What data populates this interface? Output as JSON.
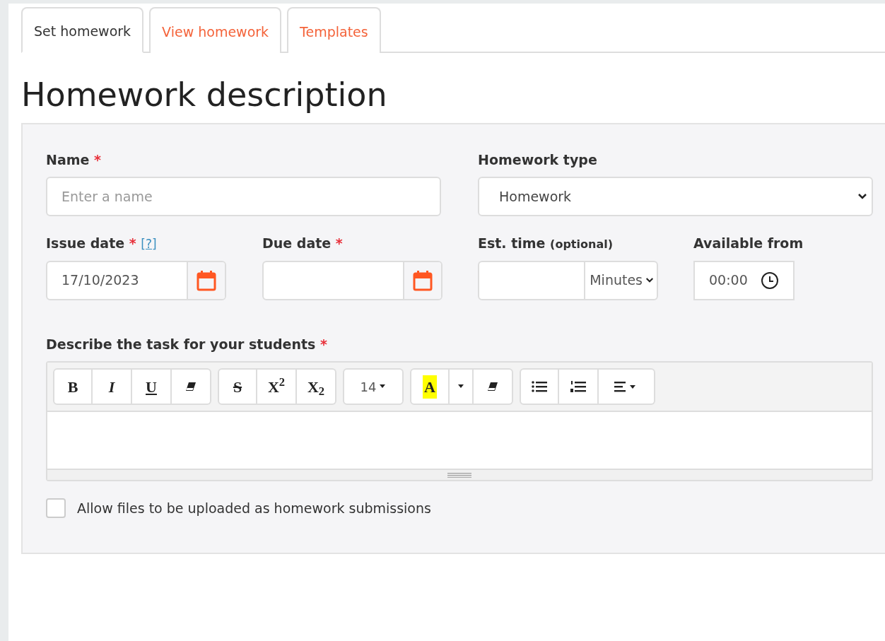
{
  "tabs": [
    {
      "label": "Set homework",
      "selected": true
    },
    {
      "label": "View homework",
      "selected": false
    },
    {
      "label": "Templates",
      "selected": false
    }
  ],
  "heading": "Homework description",
  "form": {
    "name": {
      "label": "Name",
      "required_mark": "*",
      "placeholder": "Enter a name"
    },
    "homework_type": {
      "label": "Homework type",
      "value": "Homework"
    },
    "issue_date": {
      "label": "Issue date",
      "required_mark": "*",
      "help": "[?]",
      "value": "17/10/2023"
    },
    "due_date": {
      "label": "Due date",
      "required_mark": "*"
    },
    "est_time": {
      "label": "Est. time",
      "hint": "(optional)",
      "unit": "Minutes"
    },
    "available_from": {
      "label": "Available from",
      "value": "00:00"
    },
    "description": {
      "label": "Describe the task for your students",
      "required_mark": "*",
      "toolbar": [
        [
          {
            "kind": "bold",
            "text": "B"
          },
          {
            "kind": "italic",
            "text": "I"
          },
          {
            "kind": "underline",
            "text": "U"
          },
          {
            "kind": "eraser"
          }
        ],
        [
          {
            "kind": "strike",
            "text": "S"
          },
          {
            "kind": "sup",
            "text": "X$^{2}$"
          },
          {
            "kind": "sub",
            "text": "X$_{2}$"
          }
        ],
        [
          {
            "kind": "dropdown",
            "text": "14"
          }
        ],
        [
          {
            "kind": "highlight",
            "text": "A"
          },
          {
            "kind": "caret"
          },
          {
            "kind": "eraser"
          }
        ],
        [
          {
            "kind": "bullets"
          },
          {
            "kind": "numbers"
          },
          {
            "kind": "align"
          }
        ]
      ]
    },
    "allow_files": {
      "label": "Allow files to be uploaded as homework submissions",
      "checked": false
    }
  }
}
